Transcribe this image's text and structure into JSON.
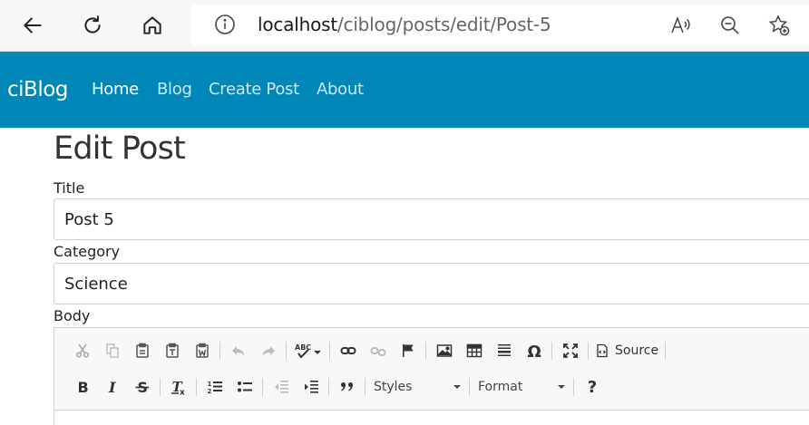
{
  "browser": {
    "url_host": "localhost",
    "url_path": "/ciblog/posts/edit/Post-5",
    "icons": [
      "back-arrow-icon",
      "refresh-icon",
      "home-icon",
      "info-icon",
      "read-aloud-icon",
      "zoom-out-icon",
      "add-favorite-icon"
    ]
  },
  "navbar": {
    "brand": "ciBlog",
    "links": [
      "Home",
      "Blog",
      "Create Post",
      "About"
    ],
    "background": "#0087b8"
  },
  "page": {
    "title": "Edit Post",
    "fields": {
      "title_label": "Title",
      "title_value": "Post 5",
      "category_label": "Category",
      "category_value": "Science",
      "body_label": "Body"
    }
  },
  "editor": {
    "source_label": "Source",
    "styles_label": "Styles",
    "format_label": "Format",
    "help_label": "?"
  }
}
